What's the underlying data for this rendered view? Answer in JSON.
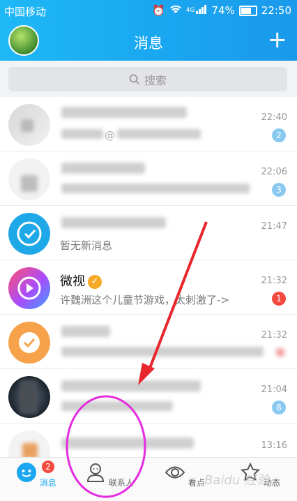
{
  "status_bar": {
    "carrier": "中国移动",
    "network": "4G",
    "battery": "74%",
    "time": "22:50"
  },
  "header": {
    "title": "消息",
    "add_label": "+"
  },
  "search": {
    "placeholder": "搜索"
  },
  "conversations": [
    {
      "name": "",
      "preview": "@",
      "time": "22:40",
      "badge": "2",
      "badge_color": "#8ac9ef"
    },
    {
      "name": "",
      "preview": "",
      "time": "22:06",
      "badge": "3",
      "badge_color": "#8ac9ef"
    },
    {
      "name": "",
      "preview": "暂无新消息",
      "time": "21:47",
      "badge": "",
      "badge_color": ""
    },
    {
      "name": "微视",
      "preview": "许魏洲这个儿童节游戏，太刺激了->",
      "time": "21:32",
      "badge": "1",
      "badge_color": "#f24a3e"
    },
    {
      "name": "",
      "preview": "",
      "time": "21:32",
      "badge": "",
      "badge_color": ""
    },
    {
      "name": "",
      "preview": "",
      "time": "21:04",
      "badge": "8",
      "badge_color": "#8ac9ef"
    },
    {
      "name": "",
      "preview": "",
      "time": "13:16",
      "badge": "",
      "badge_color": ""
    }
  ],
  "tabbar": {
    "tabs": [
      {
        "label": "消息",
        "icon": "message-icon",
        "badge": "2",
        "active": true
      },
      {
        "label": "联系人",
        "icon": "contacts-icon",
        "active": false
      },
      {
        "label": "看点",
        "icon": "eye-icon",
        "active": false
      },
      {
        "label": "动态",
        "icon": "star-icon",
        "active": false
      }
    ]
  },
  "watermark": "Baidu 经验",
  "colors": {
    "header_blue": "#1aa7f0",
    "active_tab": "#1aa7f0",
    "annotation_arrow": "#e8262d",
    "annotation_circle": "#e52be0"
  }
}
